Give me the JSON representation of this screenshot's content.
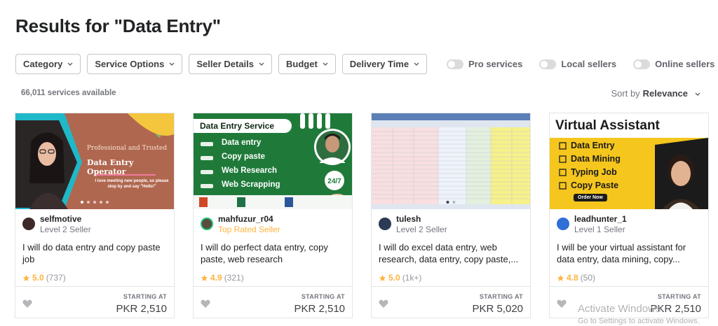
{
  "page_title": "Results for \"Data Entry\"",
  "filters": [
    "Category",
    "Service Options",
    "Seller Details",
    "Budget",
    "Delivery Time"
  ],
  "toggles": [
    "Pro services",
    "Local sellers",
    "Online sellers"
  ],
  "results_count": "66,011 services available",
  "sort": {
    "label": "Sort by",
    "value": "Relevance"
  },
  "gigs": [
    {
      "seller": "selfmotive",
      "level": "Level 2 Seller",
      "title": "I will do data entry and copy paste job",
      "rating": "5.0",
      "reviews": "(737)",
      "starting_label": "STARTING AT",
      "price": "PKR 2,510",
      "thumb": {
        "tagline": "Professional and Trusted",
        "role": "Data Entry Operator",
        "message": "I love meeting new people, so please stop by and say \"Hello!\""
      }
    },
    {
      "seller": "mahfuzur_r04",
      "level": "Top Rated Seller",
      "title": "I will do perfect data entry, copy paste, web research",
      "rating": "4.9",
      "reviews": "(321)",
      "starting_label": "STARTING AT",
      "price": "PKR 2,510",
      "thumb": {
        "header": "Data Entry Service",
        "items": [
          "Data entry",
          "Copy paste",
          "Web Research",
          "Web Scrapping"
        ],
        "badge": "24/7"
      }
    },
    {
      "seller": "tulesh",
      "level": "Level 2 Seller",
      "title": "I will do excel data entry, web research, data entry, copy paste,...",
      "rating": "5.0",
      "reviews": "(1k+)",
      "starting_label": "STARTING AT",
      "price": "PKR 5,020"
    },
    {
      "seller": "leadhunter_1",
      "level": "Level 1 Seller",
      "title": "I will be your virtual assistant for data entry, data mining, copy...",
      "rating": "4.8",
      "reviews": "(50)",
      "starting_label": "STARTING AT",
      "price": "PKR 2,510",
      "thumb": {
        "header": "Virtual Assistant",
        "items": [
          "Data Entry",
          "Data Mining",
          "Typing Job",
          "Copy Paste"
        ],
        "cta": "Order Now"
      }
    }
  ],
  "watermark": {
    "line1": "Activate Windows",
    "line2": "Go to Settings to activate Windows."
  },
  "colors": {
    "star": "#ffb33e",
    "top_rated": "#ffb33e",
    "border": "#e4e5e7"
  }
}
